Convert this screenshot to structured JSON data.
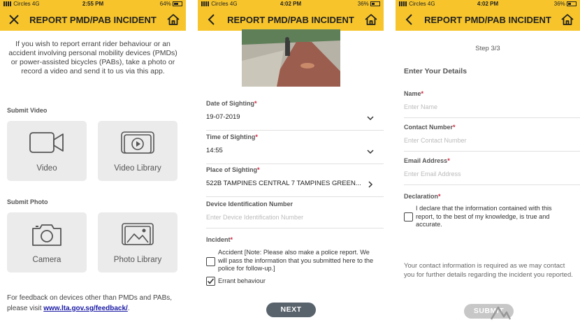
{
  "screen1": {
    "status": {
      "carrier": "Circles",
      "network": "4G",
      "time": "2:55 PM",
      "battery": "64%",
      "battery_level": 0.64
    },
    "title": "REPORT PMD/PAB INCIDENT",
    "intro": "If you wish to report errant rider behaviour or an accident involving personal mobility devices (PMDs) or power-assisted bicycles (PABs), take a photo or record a video and send it to us via this app.",
    "submit_video_label": "Submit Video",
    "video_label": "Video",
    "video_library_label": "Video Library",
    "submit_photo_label": "Submit Photo",
    "camera_label": "Camera",
    "photo_library_label": "Photo Library",
    "feedback_text": "For feedback on devices other than PMDs and PABs, please visit ",
    "feedback_link": "www.lta.gov.sg/feedback/",
    "feedback_end": "."
  },
  "screen2": {
    "status": {
      "carrier": "Circles",
      "network": "4G",
      "time": "4:02 PM",
      "battery": "36%",
      "battery_level": 0.36
    },
    "title": "REPORT PMD/PAB INCIDENT",
    "date_label": "Date of Sighting",
    "date_value": "19-07-2019",
    "time_label": "Time of Sighting",
    "time_value": "14:55",
    "place_label": "Place of Sighting",
    "place_value": "522B TAMPINES CENTRAL 7 TAMPINES GREEN...",
    "device_label": "Device Identification Number",
    "device_placeholder": "Enter Device Identification Number",
    "incident_label": "Incident",
    "accident_text": "Accident [Note: Please also make a police report. We will pass the information that you submitted here to the police for follow-up.]",
    "accident_checked": false,
    "errant_text": "Errant behaviour",
    "errant_checked": true,
    "next_label": "NEXT",
    "required_mark": "*"
  },
  "screen3": {
    "status": {
      "carrier": "Circles",
      "network": "4G",
      "time": "4:02 PM",
      "battery": "36%",
      "battery_level": 0.36
    },
    "title": "REPORT PMD/PAB INCIDENT",
    "step": "Step 3/3",
    "heading": "Enter Your Details",
    "name_label": "Name",
    "name_placeholder": "Enter Name",
    "contact_label": "Contact Number",
    "contact_placeholder": "Enter Contact Number",
    "email_label": "Email Address",
    "email_placeholder": "Enter Email Address",
    "declaration_label": "Declaration",
    "declaration_text": "I declare that the information contained with this report, to the best of my knowledge, is true and accurate.",
    "declaration_checked": false,
    "contact_note": "Your contact information is required as we may contact you for further details regarding the incident you reported.",
    "submit_label": "SUBMIT",
    "required_mark": "*"
  },
  "colors": {
    "accent": "#f7c52b",
    "required": "#d6203a",
    "next_button": "#59636c",
    "submit_disabled": "#c7c7c7",
    "link": "#1a1aa6"
  },
  "icons": [
    "close-icon",
    "back-arrow-icon",
    "home-icon",
    "video-camera-icon",
    "video-library-icon",
    "camera-icon",
    "photo-library-icon",
    "chevron-down-icon",
    "chevron-right-icon",
    "checkmark-icon"
  ]
}
